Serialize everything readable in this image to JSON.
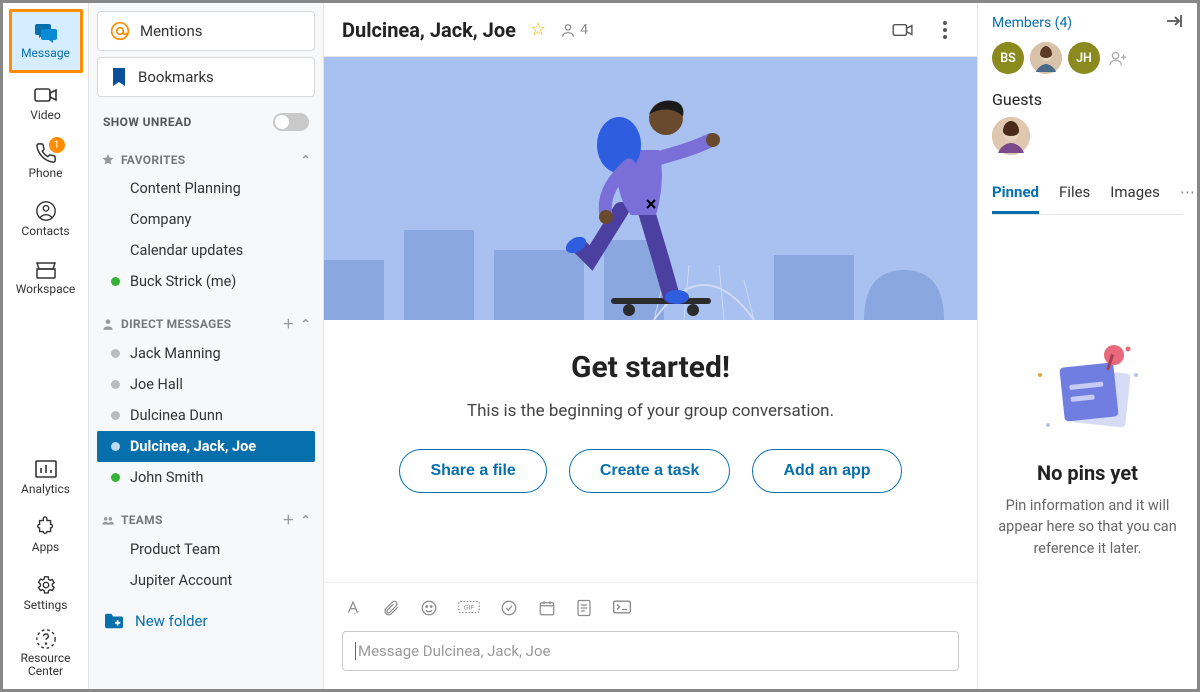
{
  "nav": {
    "items": [
      {
        "key": "message",
        "label": "Message"
      },
      {
        "key": "video",
        "label": "Video"
      },
      {
        "key": "phone",
        "label": "Phone",
        "badge": "1"
      },
      {
        "key": "contacts",
        "label": "Contacts"
      },
      {
        "key": "workspace",
        "label": "Workspace"
      },
      {
        "key": "analytics",
        "label": "Analytics"
      },
      {
        "key": "apps",
        "label": "Apps"
      },
      {
        "key": "settings",
        "label": "Settings"
      },
      {
        "key": "resource",
        "label": "Resource Center"
      }
    ]
  },
  "lists": {
    "mentions": "Mentions",
    "bookmarks": "Bookmarks",
    "showUnread": "SHOW UNREAD",
    "sections": {
      "favorites": {
        "label": "FAVORITES",
        "items": [
          {
            "label": "Content Planning"
          },
          {
            "label": "Company"
          },
          {
            "label": "Calendar updates"
          },
          {
            "label": "Buck Strick (me)",
            "online": true
          }
        ]
      },
      "dm": {
        "label": "DIRECT MESSAGES",
        "items": [
          {
            "label": "Jack Manning"
          },
          {
            "label": "Joe Hall"
          },
          {
            "label": "Dulcinea Dunn"
          },
          {
            "label": "Dulcinea, Jack, Joe",
            "active": true
          },
          {
            "label": "John Smith",
            "online": true
          }
        ]
      },
      "teams": {
        "label": "TEAMS",
        "items": [
          {
            "label": "Product Team"
          },
          {
            "label": "Jupiter Account"
          }
        ]
      }
    },
    "newFolder": "New folder"
  },
  "header": {
    "title": "Dulcinea, Jack, Joe",
    "memberCount": "4"
  },
  "center": {
    "heading": "Get started!",
    "sub": "This is the beginning of your group conversation.",
    "buttons": [
      "Share a file",
      "Create a task",
      "Add an app"
    ]
  },
  "composer": {
    "placeholder": "Message Dulcinea, Jack, Joe"
  },
  "side": {
    "membersLink": "Members (4)",
    "avatars": [
      {
        "text": "BS",
        "cls": "bs"
      },
      {
        "text": "",
        "cls": "img"
      },
      {
        "text": "JH",
        "cls": "jh"
      }
    ],
    "guestsLabel": "Guests",
    "tabs": [
      "Pinned",
      "Files",
      "Images"
    ],
    "emptyTitle": "No pins yet",
    "emptyBody": "Pin information and it will appear here so that you can reference it later."
  }
}
